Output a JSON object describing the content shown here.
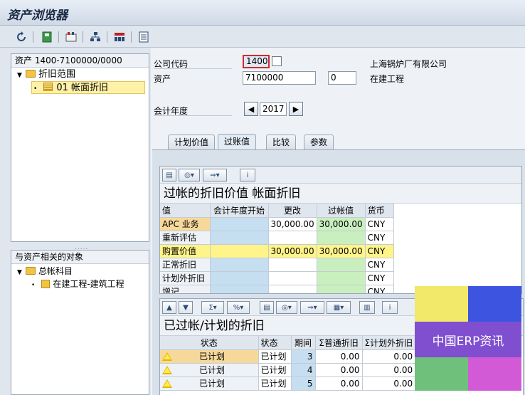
{
  "window": {
    "title": "资产浏览器"
  },
  "toolbar": {
    "icons": [
      "refresh-icon",
      "save-layout-icon",
      "asset-value-icon",
      "org-structure-icon",
      "graph-icon",
      "list-icon"
    ]
  },
  "left": {
    "tree1": {
      "header": "资产 1400-7100000/0000",
      "node_folder": "折旧范围",
      "node_selected": "01  帐面折旧"
    },
    "tree2": {
      "header": "与资产相关的对象",
      "node_folder": "总帐科目",
      "node_item": "在建工程-建筑工程"
    }
  },
  "header": {
    "company_code_label": "公司代码",
    "company_code": "1400",
    "company_name": "上海锅炉厂有限公司",
    "asset_label": "资产",
    "asset_no": "7100000",
    "sub_no": "0",
    "asset_desc": "在建工程",
    "fiscal_year_label": "会计年度",
    "fiscal_year": "2017"
  },
  "tabs": [
    "计划价值",
    "过账值",
    "比较",
    "参数"
  ],
  "active_tab": "过账值",
  "grid1": {
    "title": "过帐的折旧价值 帐面折旧",
    "columns": [
      "值",
      "会计年度开始",
      "更改",
      "过帐值",
      "货币"
    ],
    "rows": [
      [
        "APC 业务",
        "",
        "30,000.00",
        "30,000.00",
        "CNY"
      ],
      [
        "重新评估",
        "",
        "",
        "",
        "CNY"
      ],
      [
        "购置价值",
        "",
        "30,000.00",
        "30,000.00",
        "CNY"
      ],
      [
        "正常折旧",
        "",
        "",
        "",
        "CNY"
      ],
      [
        "计划外折旧",
        "",
        "",
        "",
        "CNY"
      ],
      [
        "增记",
        "",
        "",
        "",
        "CNY"
      ]
    ]
  },
  "grid2": {
    "title": "已过帐/计划的折旧",
    "columns": [
      "状态",
      "状态",
      "期间",
      "Σ普通折旧",
      "Σ计划外折旧"
    ],
    "rows": [
      [
        "已计划",
        "已计划",
        "3",
        "0.00",
        "0.00"
      ],
      [
        "已计划",
        "已计划",
        "4",
        "0.00",
        "0.00"
      ],
      [
        "已计划",
        "已计划",
        "5",
        "0.00",
        "0.00"
      ]
    ]
  },
  "watermark": {
    "text": "中国ERP资讯",
    "colors": [
      "#f2e86a",
      "#3d54e0",
      "#7f4fd0",
      "#6fc07a",
      "#d25ad6"
    ]
  }
}
